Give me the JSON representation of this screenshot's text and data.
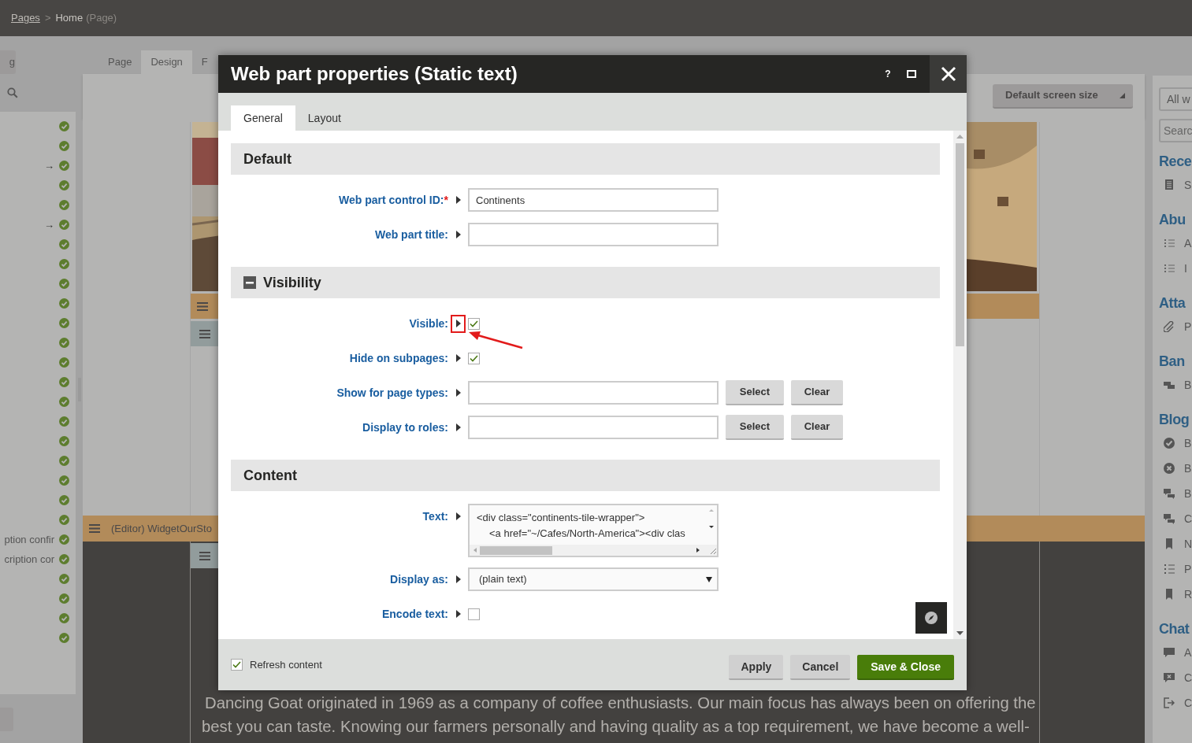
{
  "breadcrumb": {
    "link": "Pages",
    "separator": ">",
    "current": "Home",
    "type": "(Page)"
  },
  "left_panel": {
    "tab_label": "g",
    "rows": [
      {},
      {},
      {
        "arrow": "→"
      },
      {},
      {},
      {
        "arrow": "→"
      },
      {},
      {},
      {},
      {},
      {},
      {},
      {},
      {},
      {},
      {},
      {},
      {},
      {},
      {},
      {},
      {
        "label": "ption confir"
      },
      {
        "label": "cription cor"
      },
      {},
      {},
      {},
      {}
    ]
  },
  "page_tabs": [
    {
      "label": "Page",
      "selected": false
    },
    {
      "label": "Design",
      "selected": true
    },
    {
      "label": "F",
      "selected": false
    }
  ],
  "device_selector": "Default screen size",
  "editor_zone": "(Editor) WidgetOurSto",
  "page_text": [
    "Dancing Goat originated in 1969 as a company of coffee enthusiasts. Our main focus has always been on offering the",
    "best you can taste. Knowing our farmers personally and having quality as a top requirement, we have become a well-"
  ],
  "widget_panel": {
    "filter": "All w",
    "search_placeholder": "Searc",
    "groups": [
      {
        "title": "Rece",
        "items": [
          {
            "label": "S",
            "kind": "document"
          }
        ]
      },
      {
        "title": "Abu",
        "items": [
          {
            "label": "A",
            "kind": "checklist"
          },
          {
            "label": "I",
            "kind": "checklist"
          }
        ]
      },
      {
        "title": "Atta",
        "items": [
          {
            "label": "P",
            "kind": "paperclip"
          }
        ]
      },
      {
        "title": "Ban",
        "items": [
          {
            "label": "B",
            "kind": "banner"
          }
        ]
      },
      {
        "title": "Blog",
        "items": [
          {
            "label": "B",
            "kind": "check"
          },
          {
            "label": "B",
            "kind": "cross"
          },
          {
            "label": "B",
            "kind": "comments"
          },
          {
            "label": "C",
            "kind": "comments"
          },
          {
            "label": "N",
            "kind": "bookmark"
          },
          {
            "label": "P",
            "kind": "list"
          },
          {
            "label": "R",
            "kind": "bookmark"
          }
        ]
      },
      {
        "title": "Chat",
        "items": [
          {
            "label": "A",
            "kind": "chat"
          },
          {
            "label": "C",
            "kind": "chat-cross"
          },
          {
            "label": "C",
            "kind": "exit"
          }
        ]
      }
    ]
  },
  "dialog": {
    "title": "Web part properties (Static text)",
    "help": "?",
    "tabs": [
      {
        "label": "General",
        "selected": true
      },
      {
        "label": "Layout",
        "selected": false
      }
    ],
    "sections": [
      {
        "title": "Default",
        "collapsible": false,
        "fields": [
          {
            "label": "Web part control ID:",
            "required_mark": "*",
            "kind": "text",
            "value": "Continents"
          },
          {
            "label": "Web part title:",
            "kind": "text"
          }
        ]
      },
      {
        "title": "Visibility",
        "collapsible": true,
        "fields": [
          {
            "label": "Visible:",
            "kind": "checkbox",
            "checked": true,
            "highlighted": true
          },
          {
            "label": "Hide on subpages:",
            "kind": "checkbox",
            "checked": true
          },
          {
            "label": "Show for page types:",
            "kind": "selector",
            "buttons": [
              "Select",
              "Clear"
            ]
          },
          {
            "label": "Display to roles:",
            "kind": "selector",
            "buttons": [
              "Select",
              "Clear"
            ]
          }
        ]
      },
      {
        "title": "Content",
        "collapsible": false,
        "fields": [
          {
            "label": "Text:",
            "kind": "code",
            "lines": [
              "<div class=\"continents-tile-wrapper\">",
              "<a href=\"~/Cafes/North-America\"><div clas"
            ]
          },
          {
            "label": "Display as:",
            "kind": "select",
            "value": "(plain text)"
          },
          {
            "label": "Encode text:",
            "kind": "checkbox",
            "checked": false
          }
        ]
      }
    ]
  },
  "footer": {
    "refresh": {
      "label": "Refresh content",
      "checked": true
    },
    "buttons": [
      {
        "label": "Apply",
        "kind": "secondary"
      },
      {
        "label": "Cancel",
        "kind": "secondary"
      },
      {
        "label": "Save & Close",
        "kind": "primary"
      }
    ]
  }
}
